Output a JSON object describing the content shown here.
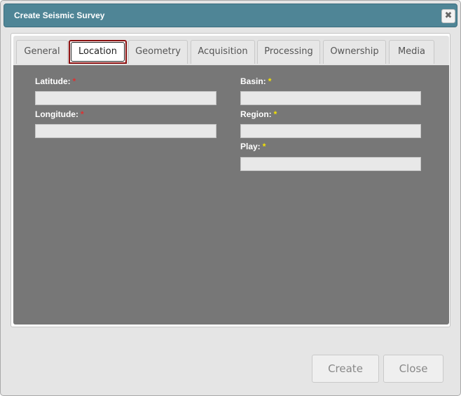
{
  "dialog": {
    "title": "Create Seismic Survey",
    "close_glyph": "✖"
  },
  "tabs": [
    {
      "label": "General"
    },
    {
      "label": "Location"
    },
    {
      "label": "Geometry"
    },
    {
      "label": "Acquisition"
    },
    {
      "label": "Processing"
    },
    {
      "label": "Ownership"
    },
    {
      "label": "Media"
    }
  ],
  "active_tab": "Location",
  "form": {
    "latitude_label": "Latitude:",
    "longitude_label": "Longitude:",
    "basin_label": "Basin:",
    "region_label": "Region:",
    "play_label": "Play:",
    "required_mark": "*",
    "latitude_value": "",
    "longitude_value": "",
    "basin_value": "",
    "region_value": "",
    "play_value": ""
  },
  "colors": {
    "titlebar": "#4f8596",
    "panel": "#777777",
    "required_red": "#e03030",
    "required_yellow": "#f5e400",
    "active_tab_highlight": "#8b0e0e"
  },
  "icons": {
    "close": "close-icon"
  },
  "buttons": {
    "create_label": "Create",
    "close_label": "Close"
  }
}
